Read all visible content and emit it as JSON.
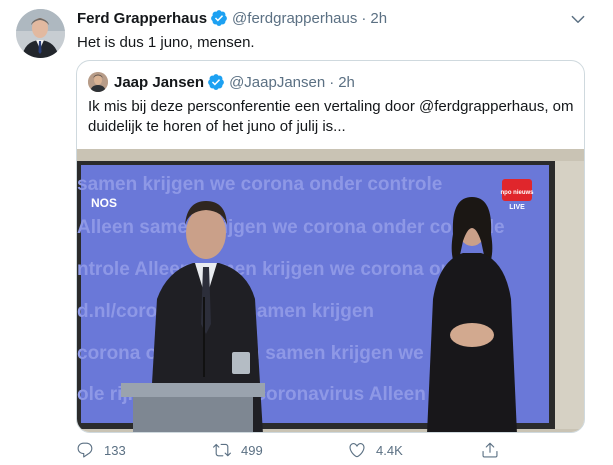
{
  "tweet": {
    "author_name": "Ferd Grapperhaus",
    "author_handle": "@ferdgrapperhaus",
    "separator": "·",
    "time": "2h",
    "text": "Het is dus 1 juno, mensen."
  },
  "quoted_tweet": {
    "author_name": "Jaap Jansen",
    "author_handle": "@JaapJansen",
    "separator": "·",
    "time": "2h",
    "text": "Ik mis bij deze persconferentie een vertaling door @ferdgrapperhaus, om duidelijk te horen of het juno of julij is...",
    "media": {
      "backdrop_lines": [
        "samen krijgen we corona onder controle",
        "Alleen samen krijgen we corona onder controle",
        "ntrole  Alleen samen krijgen we corona onder",
        "d.nl/corona  Alleen samen krijgen",
        "corona onder  Alleen samen krijgen we",
        "ole  rijksoverheid.nl/coronavirus  Alleen"
      ],
      "nos_logo": "NOS",
      "npo_badge": "npo nieuws",
      "live_label": "LIVE"
    }
  },
  "actions": {
    "reply_count": "133",
    "retweet_count": "499",
    "like_count": "4.4K"
  },
  "icons": {
    "verified": "verified-badge-icon",
    "caret": "chevron-down-icon",
    "reply": "reply-icon",
    "retweet": "retweet-icon",
    "like": "heart-icon",
    "share": "share-icon"
  },
  "colors": {
    "verified_blue": "#1da1f2",
    "secondary_text": "#5b7083",
    "backdrop_blue": "#6a78d8",
    "npo_red": "#e0262c"
  }
}
